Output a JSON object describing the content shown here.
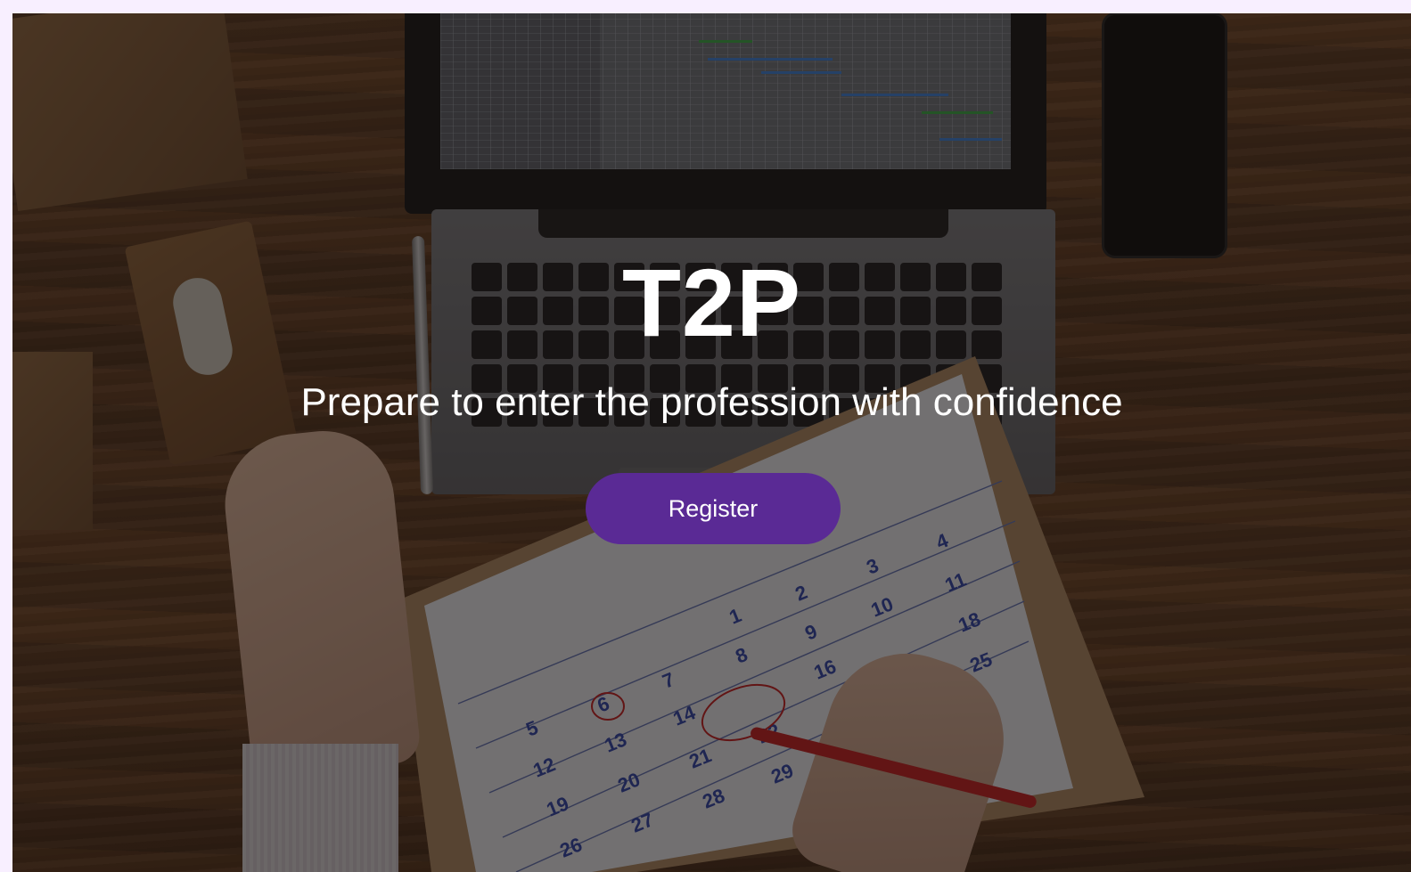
{
  "hero": {
    "title": "T2P",
    "subtitle": "Prepare to enter the profession with confidence",
    "register_label": "Register"
  },
  "colors": {
    "page_background": "#f8efff",
    "button_background": "#5a2a95",
    "text": "#ffffff"
  }
}
